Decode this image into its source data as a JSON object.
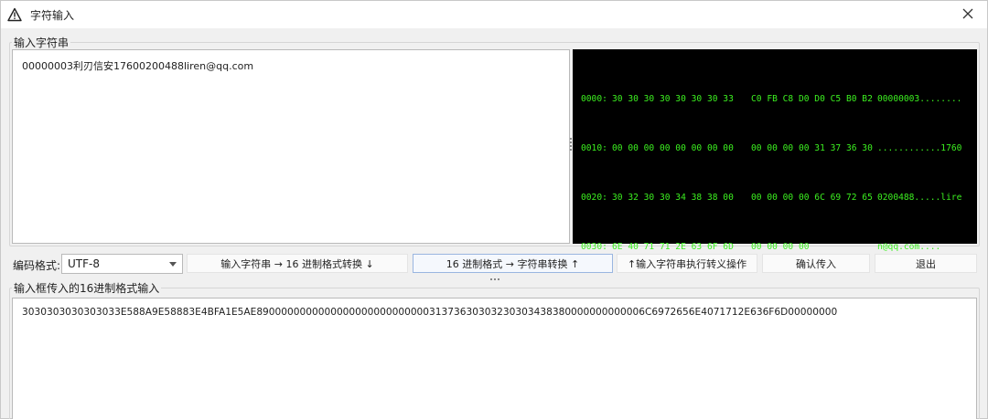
{
  "window": {
    "title": "字符输入"
  },
  "input_group": {
    "legend": "输入字符串",
    "text": "00000003利刃信安17600200488liren@qq.com"
  },
  "hex_view": {
    "rows": [
      {
        "offset": "0000:",
        "bytes1": "30 30 30 30 30 30 30 33",
        "bytes2": "C0 FB C8 D0 D0 C5 B0 B2",
        "ascii": "00000003........"
      },
      {
        "offset": "0010:",
        "bytes1": "00 00 00 00 00 00 00 00",
        "bytes2": "00 00 00 00 31 37 36 30",
        "ascii": "............1760"
      },
      {
        "offset": "0020:",
        "bytes1": "30 32 30 30 34 38 38 00",
        "bytes2": "00 00 00 00 6C 69 72 65",
        "ascii": "0200488.....lire"
      },
      {
        "offset": "0030:",
        "bytes1": "6E 40 71 71 2E 63 6F 6D",
        "bytes2": "00 00 00 00",
        "ascii": "n@qq.com...."
      }
    ]
  },
  "toolbar": {
    "encoding_label": "编码格式:",
    "encoding_value": "UTF-8",
    "btn_str_to_hex": "输入字符串 → 16 进制格式转换  ↓",
    "btn_hex_to_str": "16 进制格式 → 字符串转换  ↑",
    "btn_escape": "↑输入字符串执行转义操作",
    "btn_confirm": "确认传入",
    "btn_exit": "退出"
  },
  "hex_group": {
    "legend": "输入框传入的16进制格式输入",
    "text": "3030303030303033E588A9E58883E4BFA1E5AE890000000000000000000000000031373630303230303438380000000000006C6972656E4071712E636F6D00000000"
  }
}
